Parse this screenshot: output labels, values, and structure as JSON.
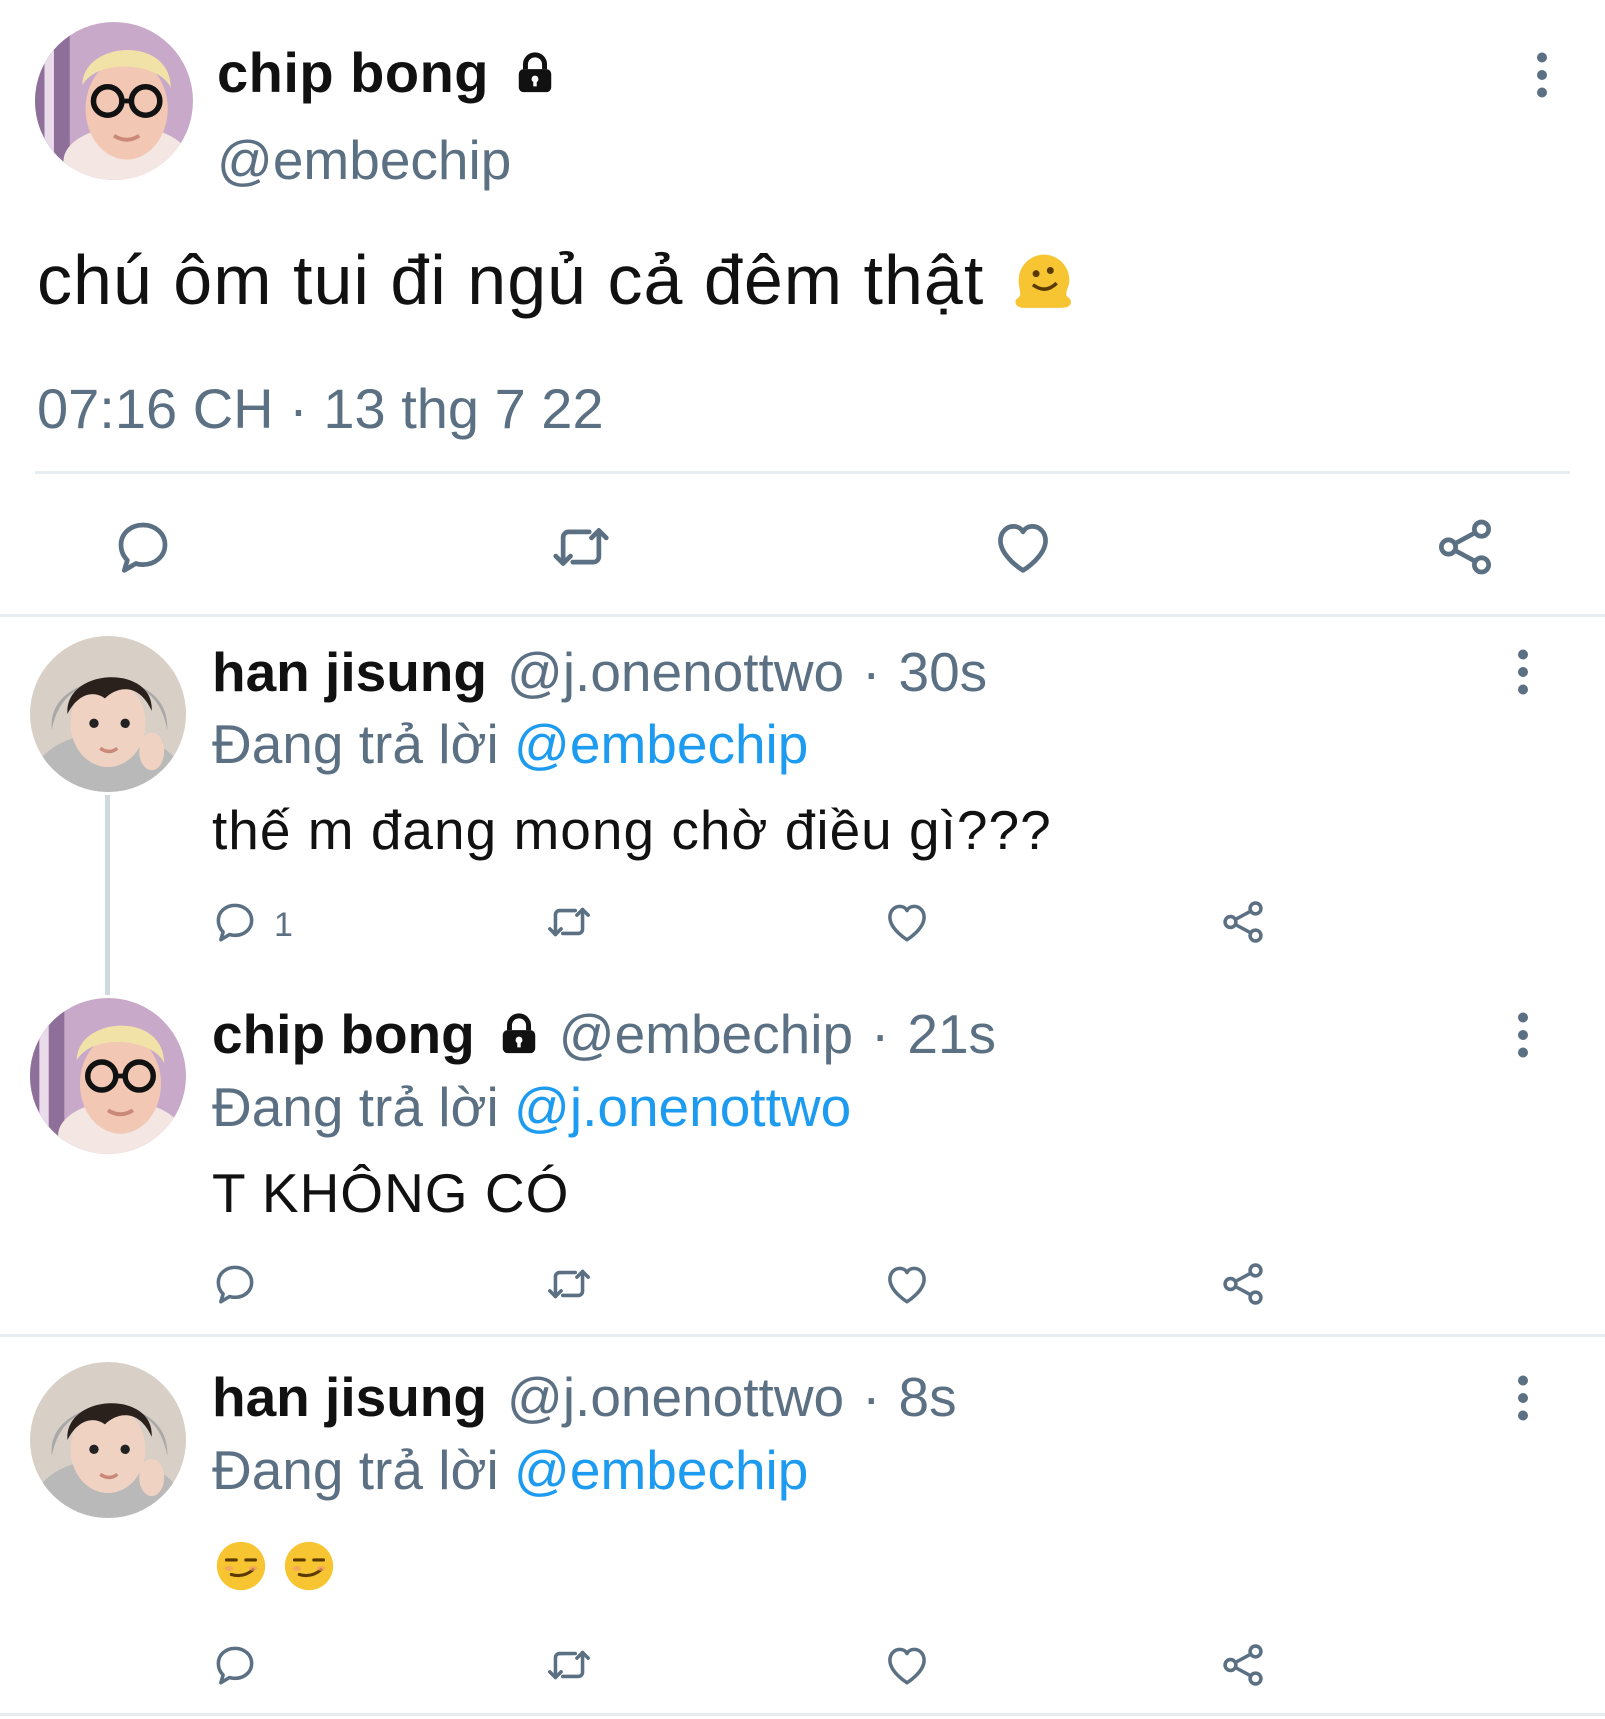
{
  "main_tweet": {
    "author_name": "chip bong",
    "handle": "@embechip",
    "text": "chú ôm tui đi ngủ cả đêm thật",
    "text_emoji": "melting-face",
    "timestamp": "07:16 CH · 13 thg 7 22",
    "actions": [
      "reply-icon",
      "retweet-icon",
      "like-icon",
      "share-icon"
    ]
  },
  "replies": [
    {
      "author_name": "han jisung",
      "handle": "@j.onenottwo",
      "sep": "·",
      "time": "30s",
      "replying_prefix": "Đang trả lời",
      "replying_to": "@embechip",
      "text": "thế m đang mong chờ điều gì???",
      "reply_count": "1"
    },
    {
      "author_name": "chip bong",
      "handle": "@embechip",
      "sep": "·",
      "time": "21s",
      "replying_prefix": "Đang trả lời",
      "replying_to": "@j.onenottwo",
      "text": "T KHÔNG CÓ",
      "reply_count": ""
    },
    {
      "author_name": "han jisung",
      "handle": "@j.onenottwo",
      "sep": "·",
      "time": "8s",
      "replying_prefix": "Đang trả lời",
      "replying_to": "@embechip",
      "text": "",
      "text_emoji": [
        "smirking-face",
        "smirking-face"
      ],
      "reply_count": ""
    }
  ],
  "colors": {
    "accent": "#1d9bf0",
    "muted": "#5b7083",
    "divider": "#e6ecf0"
  }
}
